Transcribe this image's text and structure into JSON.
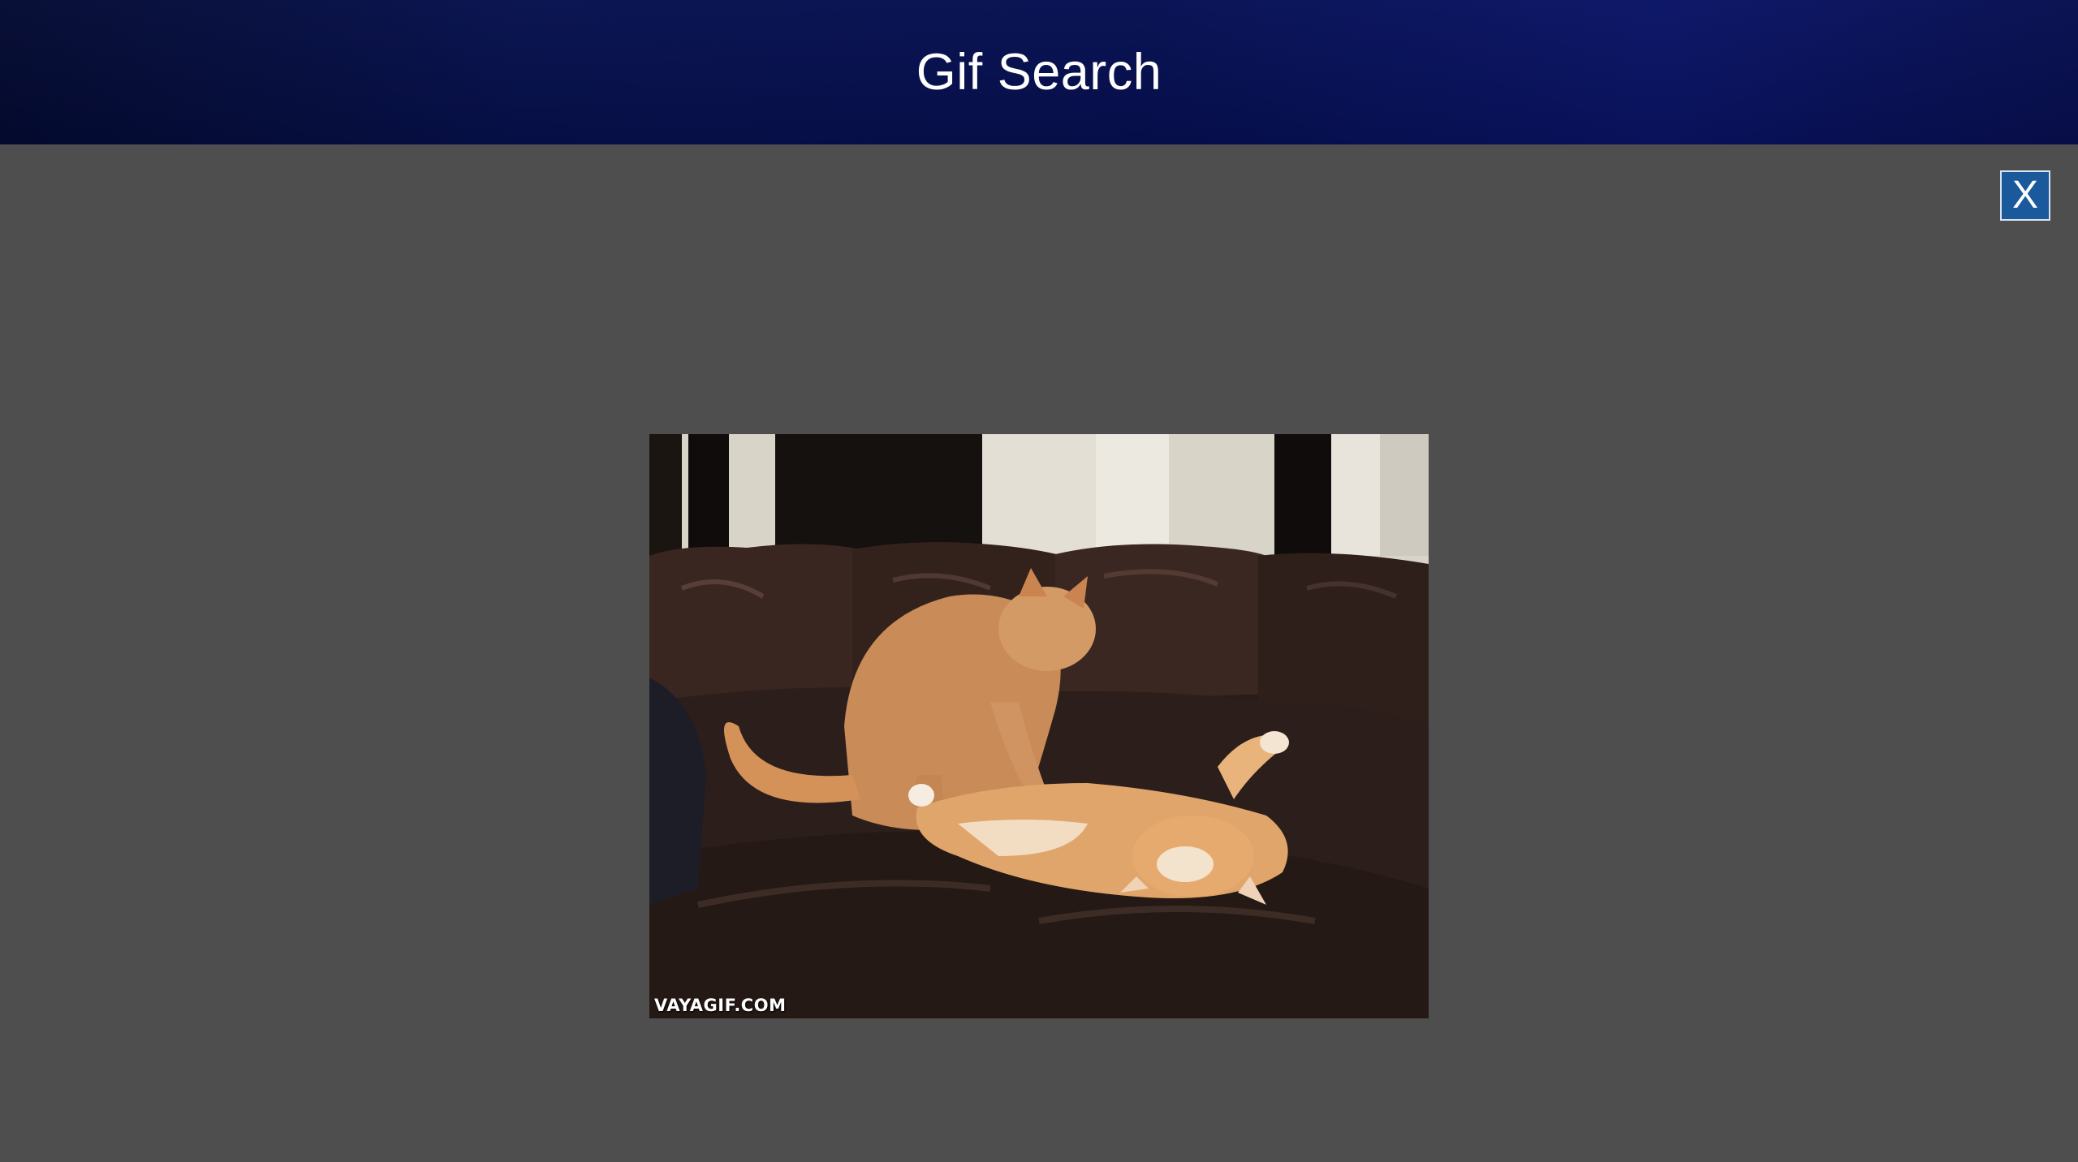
{
  "header": {
    "title": "Gif Search"
  },
  "modal": {
    "close_label": "X",
    "gif": {
      "watermark": "VAYAGIF.COM",
      "subject": "two orange cats playing on a dark leather couch"
    }
  },
  "colors": {
    "header_dark": "#040b33",
    "header_accent": "#0a1466",
    "overlay_bg": "#4e4e4e",
    "close_button_bg": "#1a5a9c"
  }
}
